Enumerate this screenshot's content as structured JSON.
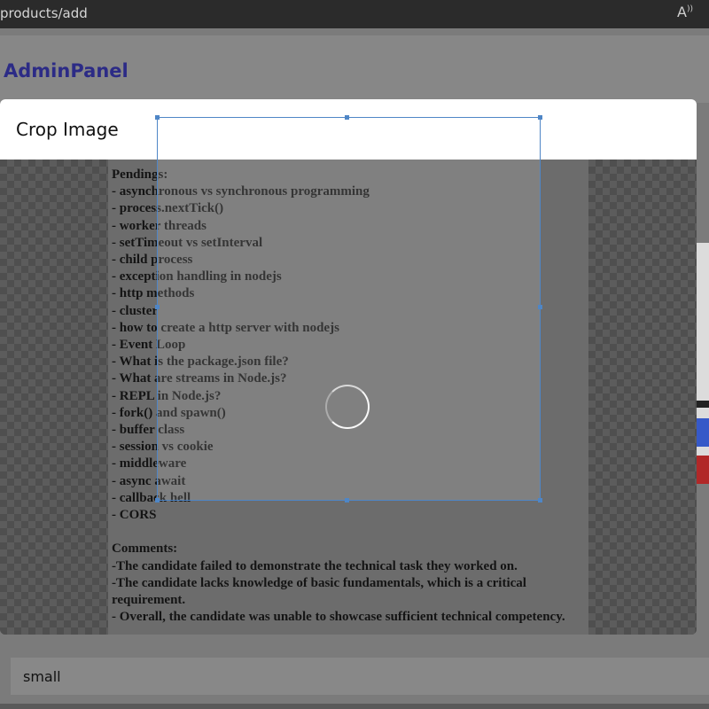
{
  "browser": {
    "url": "products/add",
    "read_aloud_icon": "read-aloud-icon"
  },
  "app": {
    "brand": "AdminPanel"
  },
  "form": {
    "size_value": "small"
  },
  "modal": {
    "title": "Crop Image",
    "document_lines": [
      "Pendings:",
      "- asynchronous vs synchronous programming",
      "- process.nextTick()",
      "- worker threads",
      "- setTimeout vs setInterval",
      "- child process",
      "- exception handling in nodejs",
      "- http methods",
      "- cluster",
      "- how to create a http server with nodejs",
      "- Event Loop",
      "- What is the package.json file?",
      "- What are streams in Node.js?",
      "- REPL in Node.js?",
      "- fork() and spawn()",
      "- buffer class",
      "- session vs cookie",
      "- middleware",
      "- async await",
      "- callback hell",
      "- CORS",
      "",
      "Comments:",
      "-The candidate failed to demonstrate the technical task they worked on.",
      "-The candidate lacks knowledge of basic fundamentals, which is a critical requirement.",
      "- Overall, the candidate was unable to showcase sufficient technical competency."
    ]
  }
}
